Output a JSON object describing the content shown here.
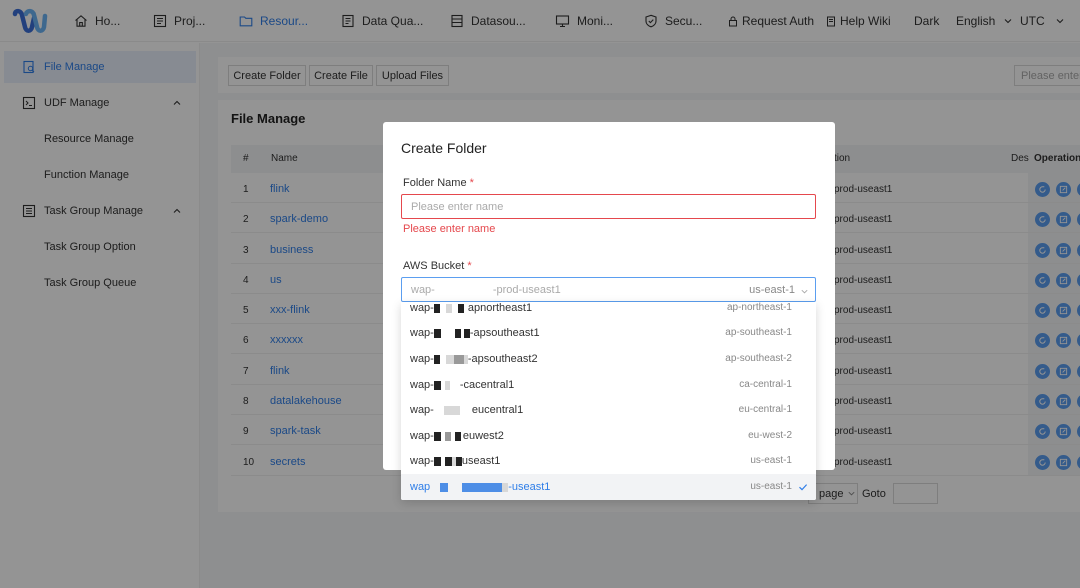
{
  "nav": {
    "items": [
      {
        "label": "Ho...",
        "icon": "home-icon"
      },
      {
        "label": "Proj...",
        "icon": "project-icon"
      },
      {
        "label": "Resour...",
        "icon": "folder-icon",
        "active": true
      },
      {
        "label": "Data Qua...",
        "icon": "data-quality-icon"
      },
      {
        "label": "Datasou...",
        "icon": "datasource-icon"
      },
      {
        "label": "Moni...",
        "icon": "monitor-icon"
      },
      {
        "label": "Secu...",
        "icon": "security-icon"
      }
    ],
    "request_auth": "Request Auth",
    "help_wiki": "Help Wiki",
    "theme": "Dark",
    "language": "English",
    "timezone": "UTC"
  },
  "sidebar": {
    "items": [
      {
        "label": "File Manage",
        "icon": "file-search-icon",
        "active": true
      },
      {
        "label": "UDF Manage",
        "icon": "udf-icon",
        "expandable": true
      },
      {
        "label": "Resource Manage",
        "sub": true
      },
      {
        "label": "Function Manage",
        "sub": true
      },
      {
        "label": "Task Group Manage",
        "icon": "task-group-icon",
        "expandable": true
      },
      {
        "label": "Task Group Option",
        "sub": true
      },
      {
        "label": "Task Group Queue",
        "sub": true
      }
    ]
  },
  "toolbar": {
    "create_folder": "Create Folder",
    "create_file": "Create File",
    "upload_files": "Upload Files",
    "search_placeholder": "Please enter"
  },
  "table": {
    "title": "File Manage",
    "headers": {
      "num": "#",
      "name": "Name",
      "desc": "tion",
      "des": "Des",
      "operation": "Operation"
    },
    "rows": [
      {
        "num": "1",
        "name": "flink",
        "desc": "prod-useast1"
      },
      {
        "num": "2",
        "name": "spark-demo",
        "desc": "prod-useast1"
      },
      {
        "num": "3",
        "name": "business",
        "desc": "prod-useast1"
      },
      {
        "num": "4",
        "name": "us",
        "desc": "prod-useast1"
      },
      {
        "num": "5",
        "name": "xxx-flink",
        "desc": "prod-useast1"
      },
      {
        "num": "6",
        "name": "xxxxxx",
        "desc": "prod-useast1"
      },
      {
        "num": "7",
        "name": "flink",
        "desc": "prod-useast1"
      },
      {
        "num": "8",
        "name": "datalakehouse",
        "desc": "prod-useast1"
      },
      {
        "num": "9",
        "name": "spark-task",
        "desc": "prod-useast1"
      },
      {
        "num": "10",
        "name": "secrets",
        "desc": "prod-useast1"
      }
    ]
  },
  "pager": {
    "per_page": "page",
    "goto": "Goto"
  },
  "modal": {
    "title": "Create Folder",
    "folder_name_label": "Folder Name",
    "required_mark": "*",
    "folder_name_placeholder": "Please enter name",
    "folder_name_error": "Please enter name",
    "bucket_label": "AWS Bucket",
    "bucket_value_prefix": "wap-",
    "bucket_value_suffix": "-prod-useast1",
    "bucket_region": "us-east-1",
    "options": [
      {
        "prefix": "wap-",
        "suffix": "apnortheast1",
        "region": "ap-northeast-1"
      },
      {
        "prefix": "wap-",
        "suffix": "-apsoutheast1",
        "region": "ap-southeast-1"
      },
      {
        "prefix": "wap-",
        "suffix": "-apsoutheast2",
        "region": "ap-southeast-2"
      },
      {
        "prefix": "wap-",
        "suffix": "-cacentral1",
        "region": "ca-central-1"
      },
      {
        "prefix": "wap-",
        "suffix": "eucentral1",
        "region": "eu-central-1"
      },
      {
        "prefix": "wap-",
        "suffix": "euwest2",
        "region": "eu-west-2"
      },
      {
        "prefix": "wap-",
        "suffix": "useast1",
        "region": "us-east-1"
      },
      {
        "prefix": "wap",
        "suffix": "-useast1",
        "region": "us-east-1",
        "selected": true
      }
    ]
  },
  "colors": {
    "accent": "#2f7ee8",
    "error": "#e5484d"
  }
}
